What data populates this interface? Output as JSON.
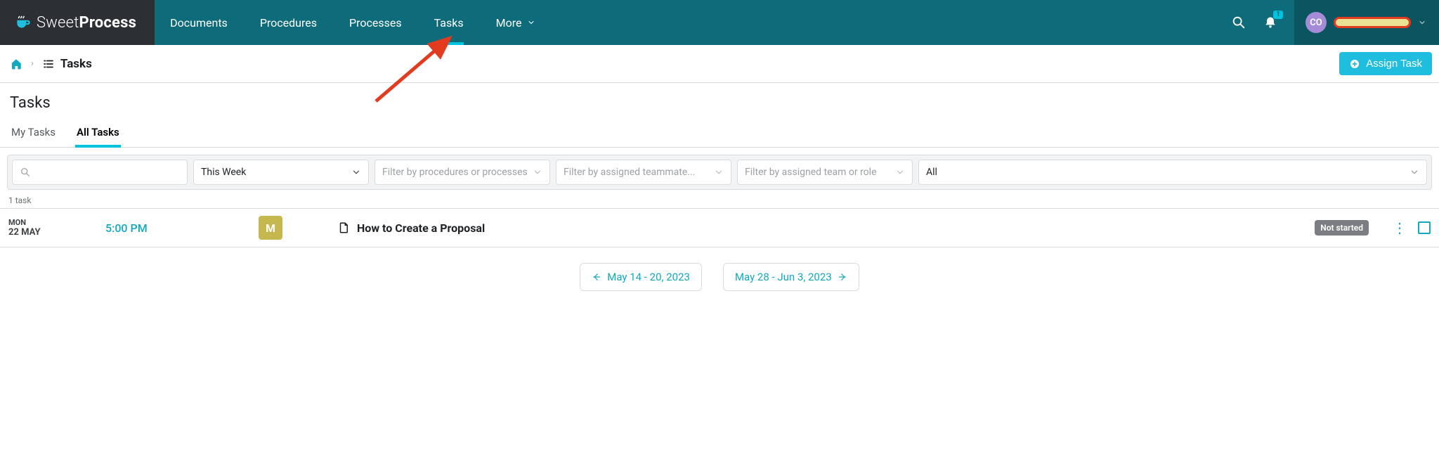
{
  "brand": {
    "word1": "Sweet",
    "word2": "Process"
  },
  "nav": {
    "items": [
      {
        "label": "Documents"
      },
      {
        "label": "Procedures"
      },
      {
        "label": "Processes"
      },
      {
        "label": "Tasks",
        "active": true
      },
      {
        "label": "More",
        "dropdown": true
      }
    ]
  },
  "notifications": {
    "count": "1"
  },
  "user": {
    "initials": "CO"
  },
  "breadcrumb": {
    "current": "Tasks"
  },
  "assign_button": "Assign Task",
  "page_title": "Tasks",
  "tabs": [
    {
      "label": "My Tasks"
    },
    {
      "label": "All Tasks",
      "active": true
    }
  ],
  "filters": {
    "period": {
      "value": "This Week"
    },
    "procedures": {
      "placeholder": "Filter by procedures or processes"
    },
    "teammates": {
      "placeholder": "Filter by assigned teammate..."
    },
    "team_role": {
      "placeholder": "Filter by assigned team or role"
    },
    "status": {
      "value": "All"
    }
  },
  "result_count": "1 task",
  "task": {
    "dow": "MON",
    "dom": "22 MAY",
    "time": "5:00 PM",
    "assignee_initial": "M",
    "title": "How to Create a Proposal",
    "status": "Not started"
  },
  "pager": {
    "prev": "May 14 - 20, 2023",
    "next": "May 28 - Jun 3, 2023"
  }
}
